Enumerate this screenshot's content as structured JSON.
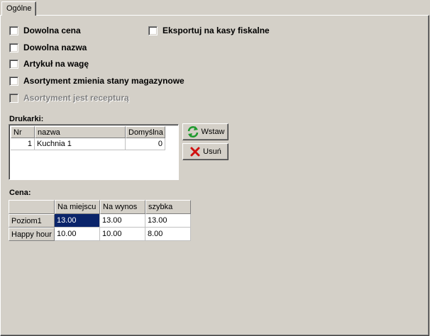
{
  "tabs": [
    {
      "label": "Ogólne"
    }
  ],
  "options": {
    "dowolna_cena": "Dowolna cena",
    "eksportuj": "Eksportuj na kasy fiskalne",
    "dowolna_nazwa": "Dowolna nazwa",
    "artykul_na_wage": "Artykuł na wagę",
    "zmienia_stany": "Asortyment zmienia stany magazynowe",
    "receptura": "Asortyment jest recepturą"
  },
  "printers": {
    "label": "Drukarki:",
    "columns": [
      "Nr",
      "nazwa",
      "Domyślna"
    ],
    "rows": [
      {
        "nr": "1",
        "nazwa": "Kuchnia 1",
        "domyslna": "0"
      }
    ],
    "insert_label": "Wstaw",
    "delete_label": "Usuń"
  },
  "price": {
    "label": "Cena:",
    "columns": [
      "Na miejscu",
      "Na wynos",
      "szybka"
    ],
    "rows": [
      {
        "name": "Poziom1",
        "values": [
          "13.00",
          "13.00",
          "13.00"
        ]
      },
      {
        "name": "Happy hour",
        "values": [
          "10.00",
          "10.00",
          "8.00"
        ]
      }
    ]
  },
  "colors": {
    "selection": "#0a246a",
    "face": "#d4d0c8"
  },
  "icons": {
    "insert": "refresh-icon",
    "delete": "red-x-icon"
  }
}
